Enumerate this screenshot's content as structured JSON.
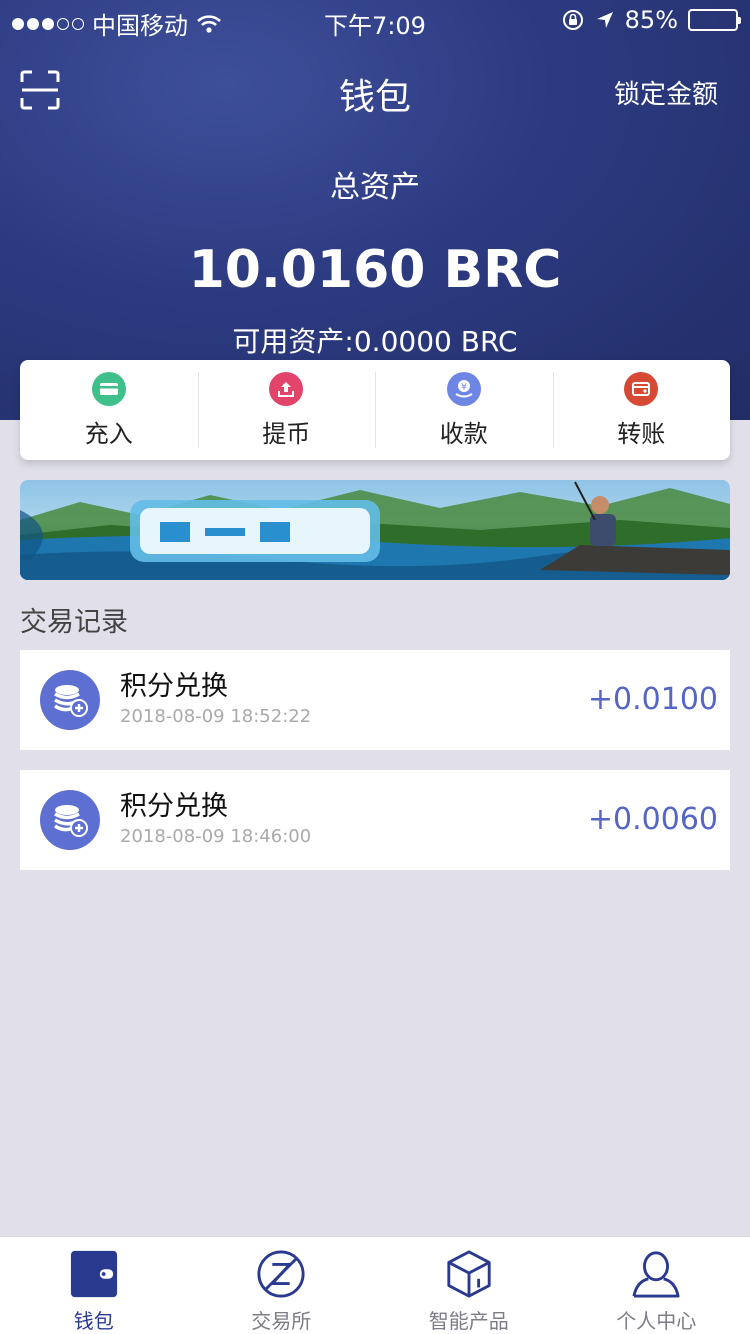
{
  "status_bar": {
    "carrier": "中国移动",
    "time": "下午7:09",
    "battery": "85%",
    "battery_level": 0.85
  },
  "nav": {
    "title": "钱包",
    "lock_label": "锁定金额"
  },
  "summary": {
    "total_label": "总资产",
    "total_amount": "10.0160 BRC",
    "available": "可用资产:0.0000 BRC"
  },
  "actions": [
    {
      "label": "充入",
      "icon": "card-icon",
      "color": "#3fc08b"
    },
    {
      "label": "提币",
      "icon": "upload-icon",
      "color": "#e2446a"
    },
    {
      "label": "收款",
      "icon": "yuan-hand-icon",
      "color": "#6d86e3"
    },
    {
      "label": "转账",
      "icon": "wallet-icon",
      "color": "#d64a35"
    }
  ],
  "section_title": "交易记录",
  "records": [
    {
      "title": "积分兑换",
      "time": "2018-08-09 18:52:22",
      "amount": "+0.0100"
    },
    {
      "title": "积分兑换",
      "time": "2018-08-09 18:46:00",
      "amount": "+0.0060"
    }
  ],
  "tabs": [
    {
      "label": "钱包",
      "active": true
    },
    {
      "label": "交易所",
      "active": false
    },
    {
      "label": "智能产品",
      "active": false
    },
    {
      "label": "个人中心",
      "active": false
    }
  ],
  "colors": {
    "header": "#2c3a80",
    "accent": "#2a3a8e",
    "amount": "#5566c4"
  }
}
